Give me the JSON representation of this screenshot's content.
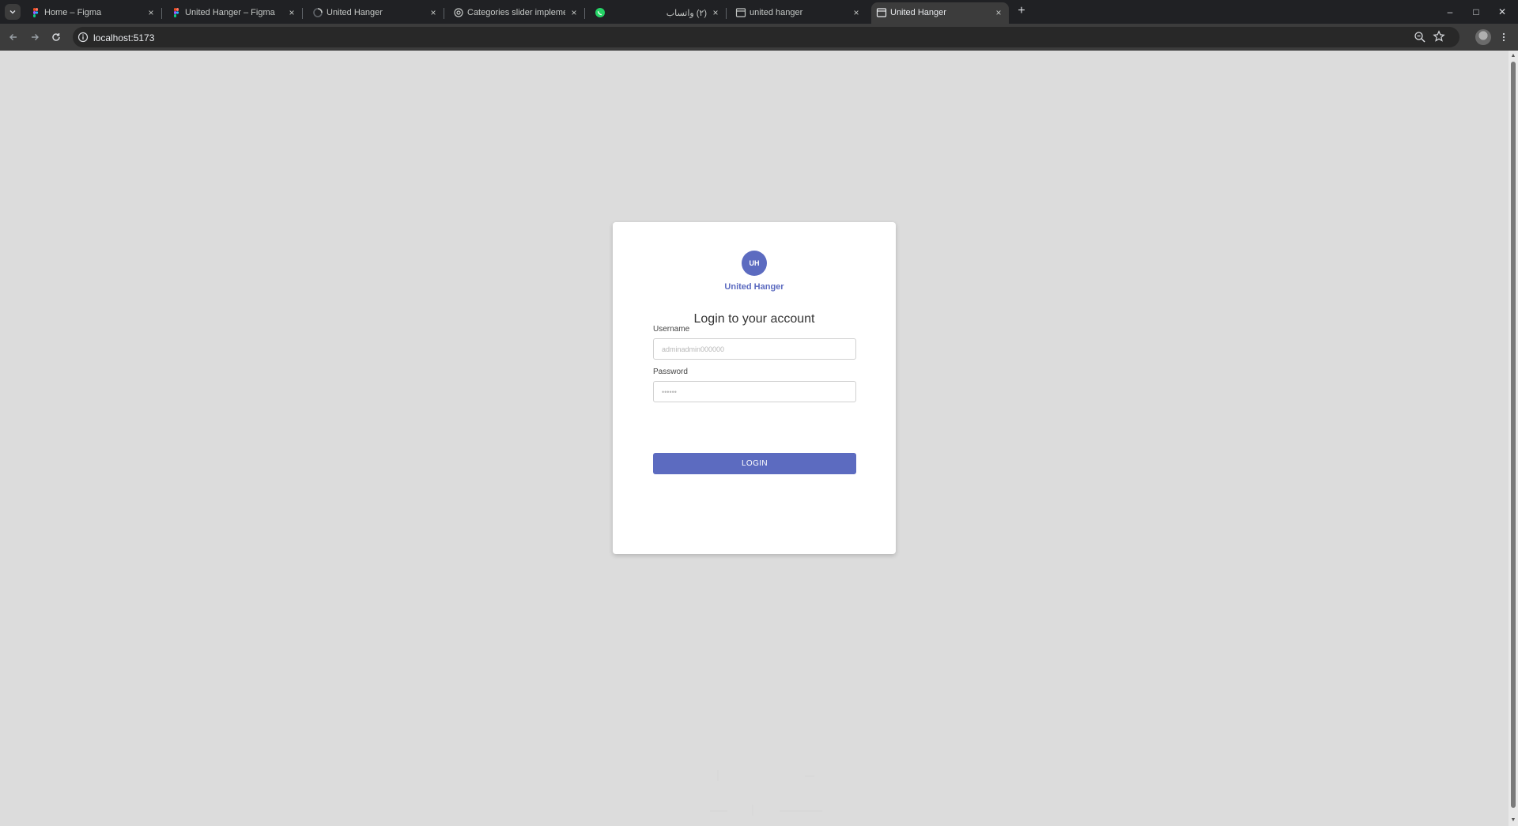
{
  "browser": {
    "tabs": [
      {
        "title": "Home – Figma",
        "icon": "figma-icon",
        "active": false
      },
      {
        "title": "United Hanger – Figma",
        "icon": "figma-icon",
        "active": false
      },
      {
        "title": "United Hanger",
        "icon": "loading-spinner-icon",
        "active": false
      },
      {
        "title": "Categories slider implementati",
        "icon": "openai-icon",
        "active": false
      },
      {
        "title": "(٢) واتساب",
        "icon": "whatsapp-icon",
        "active": false
      },
      {
        "title": "united hanger",
        "icon": "page-icon",
        "active": false
      },
      {
        "title": "United Hanger",
        "icon": "page-icon",
        "active": true
      }
    ],
    "close_glyph": "×",
    "new_tab_glyph": "+",
    "window_controls": {
      "minimize": "–",
      "maximize": "□",
      "close": "✕"
    },
    "url": "localhost:5173"
  },
  "login": {
    "logo_initials": "UH",
    "brand_name": "United Hanger",
    "heading": "Login to your account",
    "username_label": "Username",
    "username_placeholder": "adminadmin000000",
    "password_label": "Password",
    "password_placeholder": "••••••",
    "login_button": "LOGIN"
  },
  "colors": {
    "primary": "#5c6bc0",
    "page_background": "#dcdcdc",
    "browser_chrome": "#202124",
    "toolbar": "#3c3c3c"
  }
}
